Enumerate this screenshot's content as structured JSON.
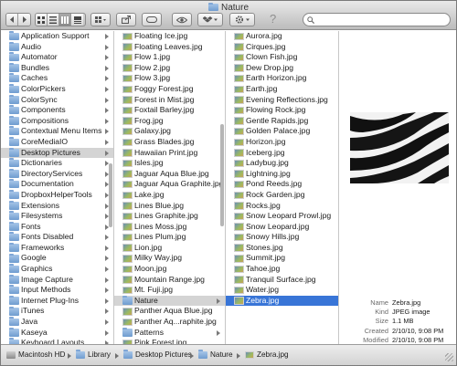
{
  "window": {
    "title": "Nature"
  },
  "toolbar": {
    "icons": [
      "back-icon",
      "forward-icon",
      "icon-view-icon",
      "list-view-icon",
      "column-view-icon",
      "coverflow-view-icon",
      "arrange-icon",
      "share-icon",
      "tag-icon",
      "quicklook-eye-icon",
      "dropbox-icon",
      "gear-icon",
      "help-icon",
      "search-icon"
    ],
    "help_glyph": "?",
    "search_placeholder": ""
  },
  "column1": {
    "items": [
      {
        "label": "Application Support",
        "selected": false
      },
      {
        "label": "Audio",
        "selected": false
      },
      {
        "label": "Automator",
        "selected": false
      },
      {
        "label": "Bundles",
        "selected": false
      },
      {
        "label": "Caches",
        "selected": false
      },
      {
        "label": "ColorPickers",
        "selected": false
      },
      {
        "label": "ColorSync",
        "selected": false
      },
      {
        "label": "Components",
        "selected": false
      },
      {
        "label": "Compositions",
        "selected": false
      },
      {
        "label": "Contextual Menu Items",
        "selected": false
      },
      {
        "label": "CoreMediaIO",
        "selected": false
      },
      {
        "label": "Desktop Pictures",
        "selected": true
      },
      {
        "label": "Dictionaries",
        "selected": false
      },
      {
        "label": "DirectoryServices",
        "selected": false
      },
      {
        "label": "Documentation",
        "selected": false
      },
      {
        "label": "DropboxHelperTools",
        "selected": false
      },
      {
        "label": "Extensions",
        "selected": false
      },
      {
        "label": "Filesystems",
        "selected": false
      },
      {
        "label": "Fonts",
        "selected": false
      },
      {
        "label": "Fonts Disabled",
        "selected": false
      },
      {
        "label": "Frameworks",
        "selected": false
      },
      {
        "label": "Google",
        "selected": false
      },
      {
        "label": "Graphics",
        "selected": false
      },
      {
        "label": "Image Capture",
        "selected": false
      },
      {
        "label": "Input Methods",
        "selected": false
      },
      {
        "label": "Internet Plug-Ins",
        "selected": false
      },
      {
        "label": "iTunes",
        "selected": false
      },
      {
        "label": "Java",
        "selected": false
      },
      {
        "label": "Kaseya",
        "selected": false
      },
      {
        "label": "Keyboard Layouts",
        "selected": false
      },
      {
        "label": "Keychains",
        "selected": false
      },
      {
        "label": "kworking",
        "selected": false
      }
    ]
  },
  "column2": {
    "items": [
      {
        "label": "Floating Ice.jpg",
        "kind": "image"
      },
      {
        "label": "Floating Leaves.jpg",
        "kind": "image"
      },
      {
        "label": "Flow 1.jpg",
        "kind": "image"
      },
      {
        "label": "Flow 2.jpg",
        "kind": "image"
      },
      {
        "label": "Flow 3.jpg",
        "kind": "image"
      },
      {
        "label": "Foggy Forest.jpg",
        "kind": "image"
      },
      {
        "label": "Forest in Mist.jpg",
        "kind": "image"
      },
      {
        "label": "Foxtail Barley.jpg",
        "kind": "image"
      },
      {
        "label": "Frog.jpg",
        "kind": "image"
      },
      {
        "label": "Galaxy.jpg",
        "kind": "image"
      },
      {
        "label": "Grass Blades.jpg",
        "kind": "image"
      },
      {
        "label": "Hawaiian Print.jpg",
        "kind": "image"
      },
      {
        "label": "Isles.jpg",
        "kind": "image"
      },
      {
        "label": "Jaguar Aqua Blue.jpg",
        "kind": "image"
      },
      {
        "label": "Jaguar Aqua Graphite.jpg",
        "kind": "image"
      },
      {
        "label": "Lake.jpg",
        "kind": "image"
      },
      {
        "label": "Lines Blue.jpg",
        "kind": "image"
      },
      {
        "label": "Lines Graphite.jpg",
        "kind": "image"
      },
      {
        "label": "Lines Moss.jpg",
        "kind": "image"
      },
      {
        "label": "Lines Plum.jpg",
        "kind": "image"
      },
      {
        "label": "Lion.jpg",
        "kind": "image"
      },
      {
        "label": "Milky Way.jpg",
        "kind": "image"
      },
      {
        "label": "Moon.jpg",
        "kind": "image"
      },
      {
        "label": "Mountain Range.jpg",
        "kind": "image"
      },
      {
        "label": "Mt. Fuji.jpg",
        "kind": "image"
      },
      {
        "label": "Nature",
        "kind": "folder",
        "selected": true
      },
      {
        "label": "Panther Aqua Blue.jpg",
        "kind": "image"
      },
      {
        "label": "Panther Aq...raphite.jpg",
        "kind": "image"
      },
      {
        "label": "Patterns",
        "kind": "folder"
      },
      {
        "label": "Pink Forest.jpg",
        "kind": "image"
      },
      {
        "label": "Pink Lotus Flower.jpg",
        "kind": "image"
      },
      {
        "label": "Plants",
        "kind": "folder"
      }
    ]
  },
  "column3": {
    "items": [
      {
        "label": "Aurora.jpg"
      },
      {
        "label": "Cirques.jpg"
      },
      {
        "label": "Clown Fish.jpg"
      },
      {
        "label": "Dew Drop.jpg"
      },
      {
        "label": "Earth Horizon.jpg"
      },
      {
        "label": "Earth.jpg"
      },
      {
        "label": "Evening Reflections.jpg"
      },
      {
        "label": "Flowing Rock.jpg"
      },
      {
        "label": "Gentle Rapids.jpg"
      },
      {
        "label": "Golden Palace.jpg"
      },
      {
        "label": "Horizon.jpg"
      },
      {
        "label": "Iceberg.jpg"
      },
      {
        "label": "Ladybug.jpg"
      },
      {
        "label": "Lightning.jpg"
      },
      {
        "label": "Pond Reeds.jpg"
      },
      {
        "label": "Rock Garden.jpg"
      },
      {
        "label": "Rocks.jpg"
      },
      {
        "label": "Snow Leopard Prowl.jpg"
      },
      {
        "label": "Snow Leopard.jpg"
      },
      {
        "label": "Snowy Hills.jpg"
      },
      {
        "label": "Stones.jpg"
      },
      {
        "label": "Summit.jpg"
      },
      {
        "label": "Tahoe.jpg"
      },
      {
        "label": "Tranquil Surface.jpg"
      },
      {
        "label": "Water.jpg"
      },
      {
        "label": "Zebra.jpg",
        "selected": true
      }
    ]
  },
  "preview": {
    "rows": [
      {
        "key": "Name",
        "value": "Zebra.jpg"
      },
      {
        "key": "Kind",
        "value": "JPEG image"
      },
      {
        "key": "Size",
        "value": "1.1 MB"
      },
      {
        "key": "Created",
        "value": "2/10/10, 9:08 PM"
      },
      {
        "key": "Modified",
        "value": "2/10/10, 9:08 PM"
      },
      {
        "key": "Last opened",
        "value": "2/10/10, 9:08 PM"
      },
      {
        "key": "Dimensions",
        "value": "2560 × 1600"
      }
    ]
  },
  "pathbar": {
    "crumbs": [
      {
        "label": "Macintosh HD",
        "icon": "hard-drive-icon"
      },
      {
        "label": "Library",
        "icon": "folder-icon"
      },
      {
        "label": "Desktop Pictures",
        "icon": "folder-icon"
      },
      {
        "label": "Nature",
        "icon": "folder-icon"
      },
      {
        "label": "Zebra.jpg",
        "icon": "image-file-icon"
      }
    ]
  },
  "colors": {
    "selection_blue": "#3875d7",
    "selection_grey": "#d4d4d4",
    "folder_blue": "#7fa6d6"
  }
}
